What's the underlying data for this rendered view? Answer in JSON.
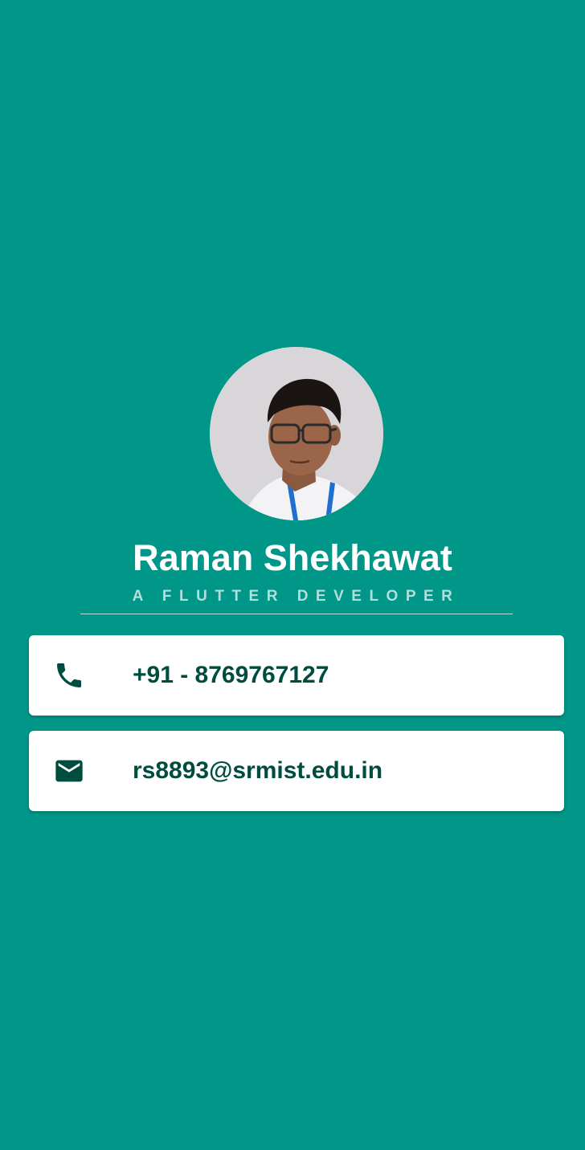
{
  "profile": {
    "name": "Raman Shekhawat",
    "title": "A FLUTTER DEVELOPER"
  },
  "contacts": {
    "phone": {
      "icon": "phone-icon",
      "value": "+91 - 8769767127"
    },
    "email": {
      "icon": "mail-icon",
      "value": "rs8893@srmist.edu.in"
    }
  },
  "colors": {
    "background": "#009688",
    "card": "#ffffff",
    "accent_text": "#004d40",
    "subtitle": "#b2dfdb"
  }
}
